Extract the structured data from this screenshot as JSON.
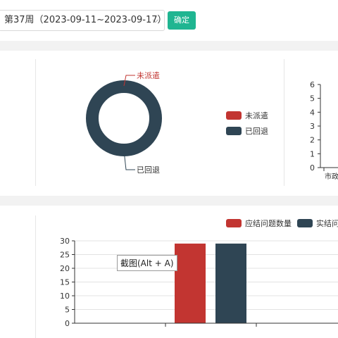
{
  "toolbar": {
    "week_select_value": "第37周（2023-09-11~2023-09-17）",
    "confirm_label": "确定"
  },
  "colors": {
    "red": "#c23531",
    "dark": "#2f4554",
    "accent": "#1fb591"
  },
  "chart_data": [
    {
      "type": "pie",
      "subtype": "donut",
      "slices": [
        {
          "name": "未派遣",
          "value": 0,
          "color": "#c23531"
        },
        {
          "name": "已回退",
          "value": 1,
          "color": "#2f4554"
        }
      ],
      "legend": [
        "未派遣",
        "已回退"
      ],
      "legend_position": "right"
    },
    {
      "type": "bar",
      "partially_visible": true,
      "ylim": [
        0,
        6
      ],
      "yticks": [
        0,
        1,
        2,
        3,
        4,
        5,
        6
      ],
      "categories": [
        "市政"
      ]
    },
    {
      "type": "bar",
      "ylim": [
        0,
        30
      ],
      "yticks": [
        0,
        5,
        10,
        15,
        20,
        25,
        30
      ],
      "series": [
        {
          "name": "应结问题数量",
          "color": "#c23531",
          "values": [
            29
          ]
        },
        {
          "name": "实结问",
          "color": "#2f4554",
          "values": [
            29
          ]
        }
      ],
      "legend_position": "top-right",
      "grid": true
    }
  ],
  "tooltip": {
    "text": "截图(Alt + A)"
  }
}
